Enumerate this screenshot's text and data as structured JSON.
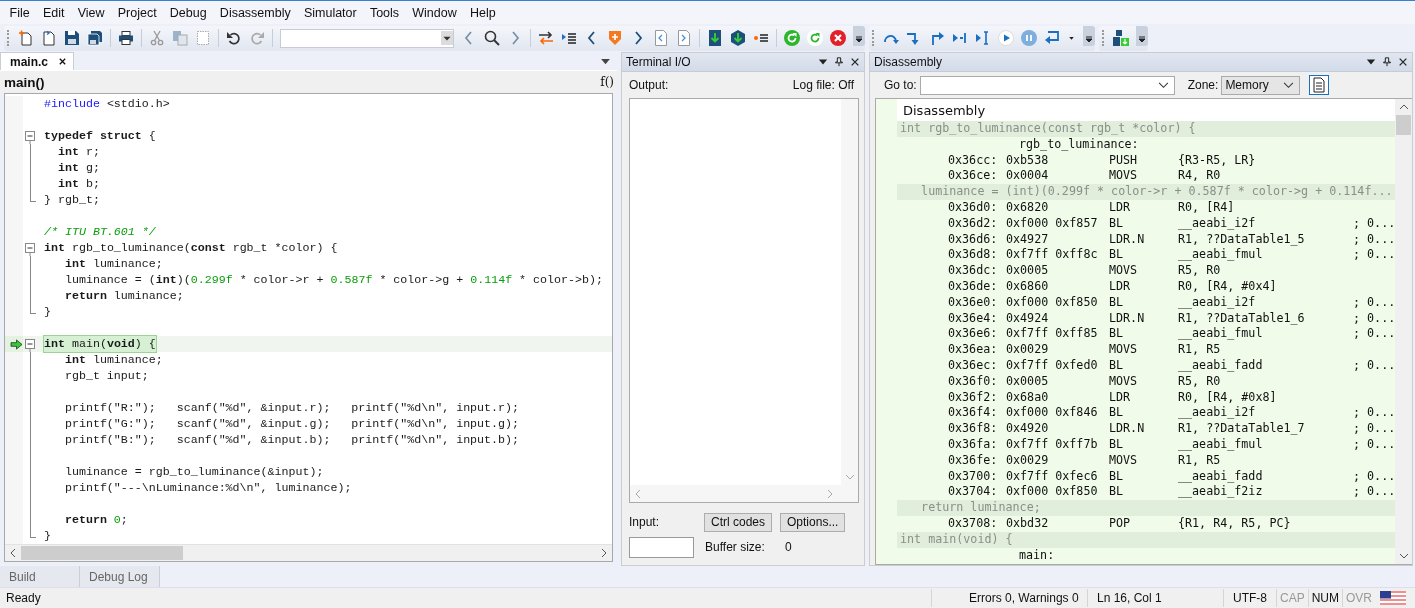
{
  "menu": [
    "File",
    "Edit",
    "View",
    "Project",
    "Debug",
    "Disassembly",
    "Simulator",
    "Tools",
    "Window",
    "Help"
  ],
  "editor": {
    "tabs": [
      {
        "label": "main.c",
        "selected": true
      }
    ],
    "scope": "main()",
    "function_button": "f()",
    "lines": [
      {
        "kind": "plain",
        "current": false,
        "parts": [
          {
            "kind": "dir",
            "text": "#include"
          },
          {
            "kind": "txt",
            "text": " <stdio.h>"
          }
        ]
      },
      {
        "kind": "plain",
        "current": false
      },
      {
        "kind": "opener",
        "current": false,
        "parts": [
          {
            "kind": "kw",
            "text": "typedef struct"
          },
          {
            "kind": "txt",
            "text": " {"
          }
        ]
      },
      {
        "kind": "inner",
        "current": false,
        "parts": [
          {
            "kind": "kw",
            "text": "  int"
          },
          {
            "kind": "txt",
            "text": " r;"
          }
        ]
      },
      {
        "kind": "inner",
        "current": false,
        "parts": [
          {
            "kind": "kw",
            "text": "  int"
          },
          {
            "kind": "txt",
            "text": " g;"
          }
        ]
      },
      {
        "kind": "inner",
        "current": false,
        "parts": [
          {
            "kind": "kw",
            "text": "  int"
          },
          {
            "kind": "txt",
            "text": " b;"
          }
        ]
      },
      {
        "kind": "closer",
        "current": false,
        "parts": [
          {
            "kind": "txt",
            "text": "} rgb_t;"
          }
        ]
      },
      {
        "kind": "plain",
        "current": false
      },
      {
        "kind": "plain",
        "current": false,
        "parts": [
          {
            "kind": "com",
            "text": "/* ITU BT.601 */"
          }
        ]
      },
      {
        "kind": "opener",
        "current": false,
        "parts": [
          {
            "kind": "kw",
            "text": "int"
          },
          {
            "kind": "txt",
            "text": " rgb_to_luminance("
          },
          {
            "kind": "kw",
            "text": "const"
          },
          {
            "kind": "txt",
            "text": " rgb_t *color) {"
          }
        ]
      },
      {
        "kind": "inner",
        "current": false,
        "parts": [
          {
            "kind": "kw",
            "text": "   int"
          },
          {
            "kind": "txt",
            "text": " luminance;"
          }
        ]
      },
      {
        "kind": "inner",
        "current": false,
        "parts": [
          {
            "kind": "txt",
            "text": "   luminance = ("
          },
          {
            "kind": "kw",
            "text": "int"
          },
          {
            "kind": "txt",
            "text": ")("
          },
          {
            "kind": "num",
            "text": "0.299f"
          },
          {
            "kind": "txt",
            "text": " * color->r + "
          },
          {
            "kind": "num",
            "text": "0.587f"
          },
          {
            "kind": "txt",
            "text": " * color->g + "
          },
          {
            "kind": "num",
            "text": "0.114f"
          },
          {
            "kind": "txt",
            "text": " * color->b);"
          }
        ]
      },
      {
        "kind": "inner",
        "current": false,
        "parts": [
          {
            "kind": "kw",
            "text": "   return"
          },
          {
            "kind": "txt",
            "text": " luminance;"
          }
        ]
      },
      {
        "kind": "closer",
        "current": false,
        "parts": [
          {
            "kind": "txt",
            "text": "}"
          }
        ]
      },
      {
        "kind": "plain",
        "current": false
      },
      {
        "kind": "opener",
        "current": true,
        "parts": [
          {
            "kind": "kw",
            "text": "int"
          },
          {
            "kind": "txt",
            "text": " main("
          },
          {
            "kind": "kw",
            "text": "void"
          },
          {
            "kind": "txt",
            "text": ") {"
          }
        ]
      },
      {
        "kind": "inner",
        "current": false,
        "parts": [
          {
            "kind": "kw",
            "text": "   int"
          },
          {
            "kind": "txt",
            "text": " luminance;"
          }
        ]
      },
      {
        "kind": "inner",
        "current": false,
        "parts": [
          {
            "kind": "txt",
            "text": "   rgb_t input;"
          }
        ]
      },
      {
        "kind": "inner",
        "current": false
      },
      {
        "kind": "inner",
        "current": false,
        "parts": [
          {
            "kind": "txt",
            "text": "   printf(\"R:\");   scanf(\"%d\", &input.r);   printf(\"%d\\n\", input.r);"
          }
        ]
      },
      {
        "kind": "inner",
        "current": false,
        "parts": [
          {
            "kind": "txt",
            "text": "   printf(\"G:\");   scanf(\"%d\", &input.g);   printf(\"%d\\n\", input.g);"
          }
        ]
      },
      {
        "kind": "inner",
        "current": false,
        "parts": [
          {
            "kind": "txt",
            "text": "   printf(\"B:\");   scanf(\"%d\", &input.b);   printf(\"%d\\n\", input.b);"
          }
        ]
      },
      {
        "kind": "inner",
        "current": false
      },
      {
        "kind": "inner",
        "current": false,
        "parts": [
          {
            "kind": "txt",
            "text": "   luminance = rgb_to_luminance(&input);"
          }
        ]
      },
      {
        "kind": "inner",
        "current": false,
        "parts": [
          {
            "kind": "txt",
            "text": "   printf(\"---\\nLuminance:%d\\n\", luminance);"
          }
        ]
      },
      {
        "kind": "inner",
        "current": false
      },
      {
        "kind": "inner",
        "current": false,
        "parts": [
          {
            "kind": "kw",
            "text": "   return "
          },
          {
            "kind": "num",
            "text": "0"
          },
          {
            "kind": "txt",
            "text": ";"
          }
        ]
      },
      {
        "kind": "closer",
        "current": false,
        "parts": [
          {
            "kind": "txt",
            "text": "}"
          }
        ]
      }
    ]
  },
  "terminal": {
    "title": "Terminal I/O",
    "output_label": "Output:",
    "log_file": "Log file: Off",
    "input_label": "Input:",
    "buttons": [
      "Ctrl codes",
      "Options..."
    ],
    "buffer_label": "Buffer size:",
    "buffer_size": "0"
  },
  "disassembly": {
    "title": "Disassembly",
    "goto_label": "Go to:",
    "zone_label": "Zone:",
    "zone": "Memory",
    "heading": "Disassembly",
    "rows": [
      {
        "kind": "source",
        "text": "int rgb_to_luminance(const rgb_t *color) {"
      },
      {
        "kind": "label",
        "text": "rgb_to_luminance:"
      },
      {
        "kind": "instr",
        "address": "0x36cc:",
        "code": "0xb538",
        "mnemonic": "PUSH",
        "operands": "{R3-R5, LR}"
      },
      {
        "kind": "instr",
        "address": "0x36ce:",
        "code": "0x0004",
        "mnemonic": "MOVS",
        "operands": "R4, R0"
      },
      {
        "kind": "source",
        "text": "   luminance = (int)(0.299f * color->r + 0.587f * color->g + 0.114f..."
      },
      {
        "kind": "instr",
        "address": "0x36d0:",
        "code": "0x6820",
        "mnemonic": "LDR",
        "operands": "R0, [R4]"
      },
      {
        "kind": "instr",
        "address": "0x36d2:",
        "code": "0xf000 0xf857",
        "mnemonic": "BL",
        "operands": "__aeabi_i2f",
        "comment": "; 0..."
      },
      {
        "kind": "instr",
        "address": "0x36d6:",
        "code": "0x4927",
        "mnemonic": "LDR.N",
        "operands": "R1, ??DataTable1_5",
        "comment": "; 0..."
      },
      {
        "kind": "instr",
        "address": "0x36d8:",
        "code": "0xf7ff 0xff8c",
        "mnemonic": "BL",
        "operands": "__aeabi_fmul",
        "comment": "; 0..."
      },
      {
        "kind": "instr",
        "address": "0x36dc:",
        "code": "0x0005",
        "mnemonic": "MOVS",
        "operands": "R5, R0"
      },
      {
        "kind": "instr",
        "address": "0x36de:",
        "code": "0x6860",
        "mnemonic": "LDR",
        "operands": "R0, [R4, #0x4]"
      },
      {
        "kind": "instr",
        "address": "0x36e0:",
        "code": "0xf000 0xf850",
        "mnemonic": "BL",
        "operands": "__aeabi_i2f",
        "comment": "; 0..."
      },
      {
        "kind": "instr",
        "address": "0x36e4:",
        "code": "0x4924",
        "mnemonic": "LDR.N",
        "operands": "R1, ??DataTable1_6",
        "comment": "; 0..."
      },
      {
        "kind": "instr",
        "address": "0x36e6:",
        "code": "0xf7ff 0xff85",
        "mnemonic": "BL",
        "operands": "__aeabi_fmul",
        "comment": "; 0..."
      },
      {
        "kind": "instr",
        "address": "0x36ea:",
        "code": "0x0029",
        "mnemonic": "MOVS",
        "operands": "R1, R5"
      },
      {
        "kind": "instr",
        "address": "0x36ec:",
        "code": "0xf7ff 0xfed0",
        "mnemonic": "BL",
        "operands": "__aeabi_fadd",
        "comment": "; 0..."
      },
      {
        "kind": "instr",
        "address": "0x36f0:",
        "code": "0x0005",
        "mnemonic": "MOVS",
        "operands": "R5, R0"
      },
      {
        "kind": "instr",
        "address": "0x36f2:",
        "code": "0x68a0",
        "mnemonic": "LDR",
        "operands": "R0, [R4, #0x8]"
      },
      {
        "kind": "instr",
        "address": "0x36f4:",
        "code": "0xf000 0xf846",
        "mnemonic": "BL",
        "operands": "__aeabi_i2f",
        "comment": "; 0..."
      },
      {
        "kind": "instr",
        "address": "0x36f8:",
        "code": "0x4920",
        "mnemonic": "LDR.N",
        "operands": "R1, ??DataTable1_7",
        "comment": "; 0..."
      },
      {
        "kind": "instr",
        "address": "0x36fa:",
        "code": "0xf7ff 0xff7b",
        "mnemonic": "BL",
        "operands": "__aeabi_fmul",
        "comment": "; 0..."
      },
      {
        "kind": "instr",
        "address": "0x36fe:",
        "code": "0x0029",
        "mnemonic": "MOVS",
        "operands": "R1, R5"
      },
      {
        "kind": "instr",
        "address": "0x3700:",
        "code": "0xf7ff 0xfec6",
        "mnemonic": "BL",
        "operands": "__aeabi_fadd",
        "comment": "; 0..."
      },
      {
        "kind": "instr",
        "address": "0x3704:",
        "code": "0xf000 0xf850",
        "mnemonic": "BL",
        "operands": "__aeabi_f2iz",
        "comment": "; 0..."
      },
      {
        "kind": "source",
        "text": "   return luminance;"
      },
      {
        "kind": "instr",
        "address": "0x3708:",
        "code": "0xbd32",
        "mnemonic": "POP",
        "operands": "{R1, R4, R5, PC}"
      },
      {
        "kind": "source",
        "text": "int main(void) {"
      },
      {
        "kind": "label",
        "text": "main:"
      }
    ]
  },
  "bottom_tabs": [
    {
      "label": "Build",
      "selected": false
    },
    {
      "label": "Debug Log",
      "selected": false
    }
  ],
  "status_bar": {
    "message": "Ready",
    "errors": "Errors 0, Warnings 0",
    "position": "Ln 16, Col 1",
    "encoding": "UTF-8",
    "indicators": [
      {
        "label": "CAP",
        "on": false
      },
      {
        "label": "NUM",
        "on": true
      },
      {
        "label": "OVR",
        "on": false
      }
    ]
  }
}
